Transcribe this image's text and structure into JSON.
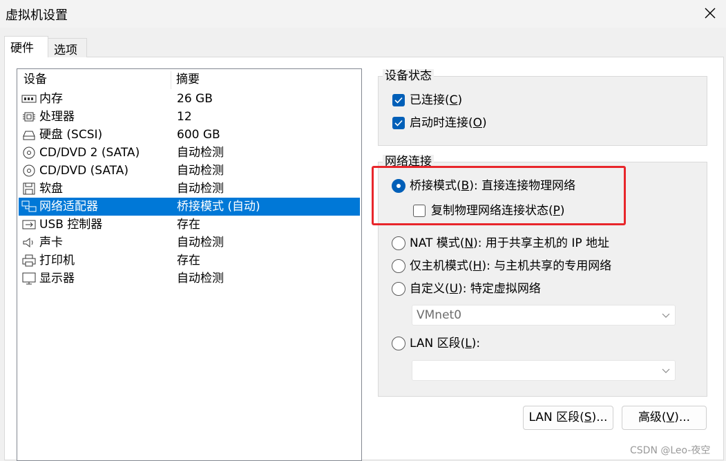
{
  "window": {
    "title": "虚拟机设置"
  },
  "tabs": [
    {
      "label": "硬件",
      "active": true
    },
    {
      "label": "选项",
      "active": false
    }
  ],
  "device_list": {
    "headers": {
      "device": "设备",
      "summary": "摘要"
    },
    "rows": [
      {
        "icon": "memory-icon",
        "name": "内存",
        "summary": "26 GB"
      },
      {
        "icon": "processor-icon",
        "name": "处理器",
        "summary": "12"
      },
      {
        "icon": "harddisk-icon",
        "name": "硬盘 (SCSI)",
        "summary": "600 GB"
      },
      {
        "icon": "cd-dvd-icon",
        "name": "CD/DVD 2 (SATA)",
        "summary": "自动检测"
      },
      {
        "icon": "cd-dvd-icon",
        "name": "CD/DVD (SATA)",
        "summary": "自动检测"
      },
      {
        "icon": "floppy-icon",
        "name": "软盘",
        "summary": "自动检测"
      },
      {
        "icon": "network-adapter-icon",
        "name": "网络适配器",
        "summary": "桥接模式 (自动)",
        "selected": true
      },
      {
        "icon": "usb-icon",
        "name": "USB 控制器",
        "summary": "存在"
      },
      {
        "icon": "sound-icon",
        "name": "声卡",
        "summary": "自动检测"
      },
      {
        "icon": "printer-icon",
        "name": "打印机",
        "summary": "存在"
      },
      {
        "icon": "display-icon",
        "name": "显示器",
        "summary": "自动检测"
      }
    ]
  },
  "device_status": {
    "title": "设备状态",
    "connected": {
      "pre": "已连接(",
      "key": "C",
      "post": ")",
      "checked": true
    },
    "connect_on_power": {
      "pre": "启动时连接(",
      "key": "O",
      "post": ")",
      "checked": true
    }
  },
  "network": {
    "title": "网络连接",
    "bridged": {
      "pre": "桥接模式(",
      "key": "B",
      "post": "): 直接连接物理网络",
      "selected": true
    },
    "replicate": {
      "pre": "复制物理网络连接状态(",
      "key": "P",
      "post": ")",
      "checked": false
    },
    "nat": {
      "pre": "NAT 模式(",
      "key": "N",
      "post": "): 用于共享主机的 IP 地址",
      "selected": false
    },
    "host_only": {
      "pre": "仅主机模式(",
      "key": "H",
      "post": "): 与主机共享的专用网络",
      "selected": false
    },
    "custom": {
      "pre": "自定义(",
      "key": "U",
      "post": "): 特定虚拟网络",
      "selected": false
    },
    "custom_select_value": "VMnet0",
    "lan_segment": {
      "pre": "LAN 区段(",
      "key": "L",
      "post": "):",
      "selected": false
    },
    "lan_select_value": ""
  },
  "buttons": {
    "lan_segments": {
      "pre": "LAN 区段(",
      "key": "S",
      "post": ")..."
    },
    "advanced": {
      "pre": "高级(",
      "key": "V",
      "post": ")..."
    }
  },
  "colors": {
    "accent": "#005fb8",
    "selection": "#0078d7",
    "highlight": "#e8262b"
  },
  "watermark": "CSDN @Leo-夜空"
}
